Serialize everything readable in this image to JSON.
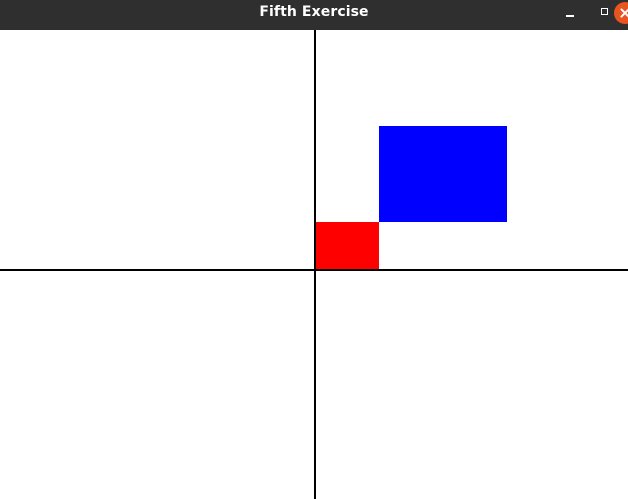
{
  "window": {
    "title": "Fifth Exercise"
  },
  "controls": {
    "minimize_icon": "minimize-icon",
    "maximize_icon": "maximize-icon",
    "close_icon": "close-icon"
  },
  "colors": {
    "titlebar": "#2f2f2f",
    "close_button": "#e95420",
    "axis": "#000000",
    "red_rectangle": "#ff0000",
    "blue_rectangle": "#0000ff"
  }
}
